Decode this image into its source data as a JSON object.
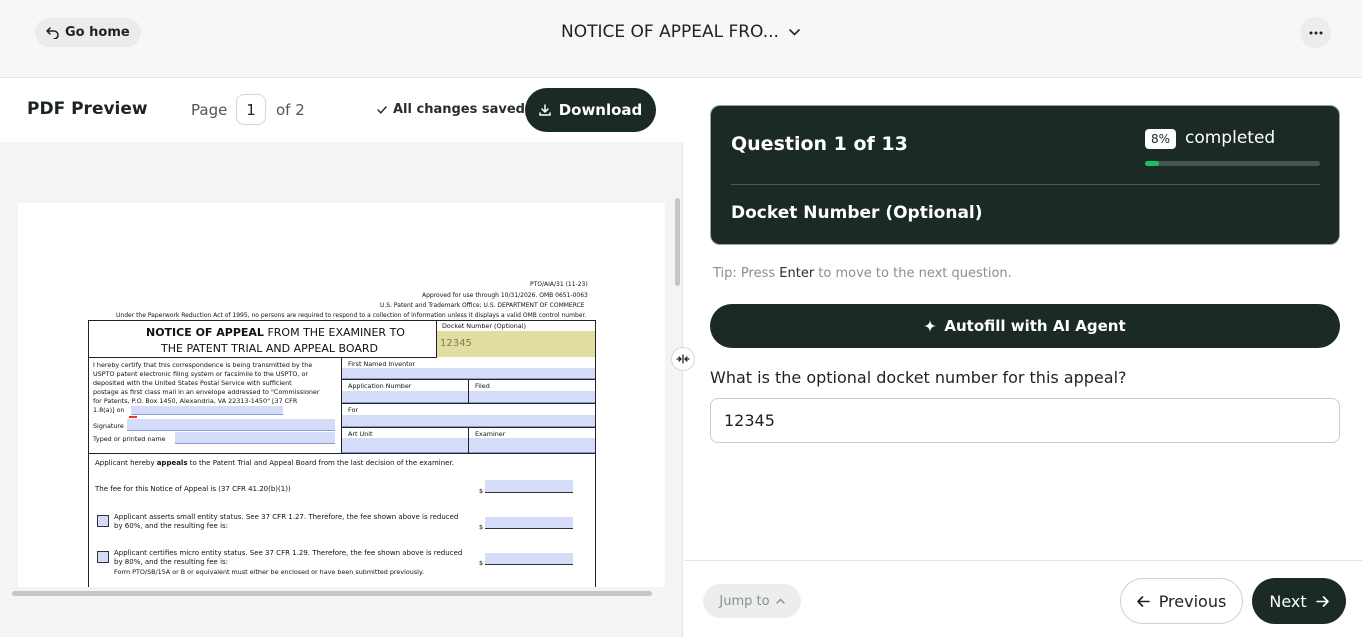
{
  "header": {
    "go_home_label": "Go home",
    "document_title": "NOTICE OF APPEAL FRO...",
    "more_icon": "ellipsis-icon"
  },
  "preview": {
    "title": "PDF Preview",
    "page_label": "Page",
    "current_page": "1",
    "of_label": "of 2",
    "save_status": "All changes saved",
    "download_label": "Download"
  },
  "pdf": {
    "form_id": "PTO/AIA/31 (11-23)",
    "approved": "Approved for use through 10/31/2026. OMB 0651-0063",
    "office": "U.S. Patent and Trademark Office; U.S. DEPARTMENT OF COMMERCE",
    "paperwork": "Under the Paperwork Reduction Act of 1995, no persons are required to respond to a collection of information unless it displays a valid OMB control number.",
    "title_bold": "NOTICE OF APPEAL",
    "title_rest": " FROM THE EXAMINER TO",
    "title_line2": "THE PATENT TRIAL AND APPEAL BOARD",
    "docket_label": "Docket Number (Optional)",
    "docket_value": "12345",
    "cert_lines": [
      "I hereby certify that this correspondence is being transmitted by the",
      "USPTO patent electronic filing system or facsimile to the USPTO, or",
      "deposited with the United States Postal Service with sufficient",
      "postage as first class mail in an envelope addressed to \"Commissioner",
      "for Patents, P.O. Box 1450, Alexandria, VA 22313-1450\" [37 CFR",
      "1.8(a)] on"
    ],
    "signature_label": "Signature",
    "typed_name_label": "Typed or printed name",
    "first_inventor_label": "First Named Inventor",
    "application_label": "Application Number",
    "filed_label": "Filed",
    "for_label": "For",
    "art_unit_label": "Art Unit",
    "examiner_label": "Examiner",
    "appeals_pre": "Applicant hereby ",
    "appeals_bold": "appeals",
    "appeals_post": " to the Patent Trial and Appeal Board from the last decision of the examiner.",
    "fee_line": "The fee for this Notice of Appeal is (37 CFR 41.20(b)(1))",
    "small_entity_1": "Applicant asserts small entity status. See 37 CFR 1.27. Therefore, the fee shown above is reduced",
    "small_entity_2": "by 60%, and the resulting fee is:",
    "micro_entity_1": "Applicant certifies micro entity status. See 37 CFR 1.29. Therefore, the fee shown above is reduced",
    "micro_entity_2": "by 80%, and the resulting fee is:",
    "micro_entity_3": "Form PTO/SB/15A or B or equivalent must either be enclosed or have been submitted previously.",
    "dollar": "$"
  },
  "question_card": {
    "question_counter": "Question 1 of 13",
    "percent_label": "8%",
    "percent_value": 8,
    "completed_label": "completed",
    "field_title": "Docket Number (Optional)"
  },
  "tip": {
    "prefix": "Tip: Press ",
    "key": "Enter",
    "suffix": " to move to the next question."
  },
  "autofill_label": "Autofill with AI Agent",
  "question_text": "What is the optional docket number for this appeal?",
  "answer_value": "12345",
  "footer": {
    "jump_label": "Jump to",
    "previous_label": "Previous",
    "next_label": "Next"
  },
  "colors": {
    "accent_dark": "#1c2a26",
    "progress_green": "#1fbf57",
    "field_blue": "#d4dcf7",
    "field_yellow": "#e2dea0"
  }
}
